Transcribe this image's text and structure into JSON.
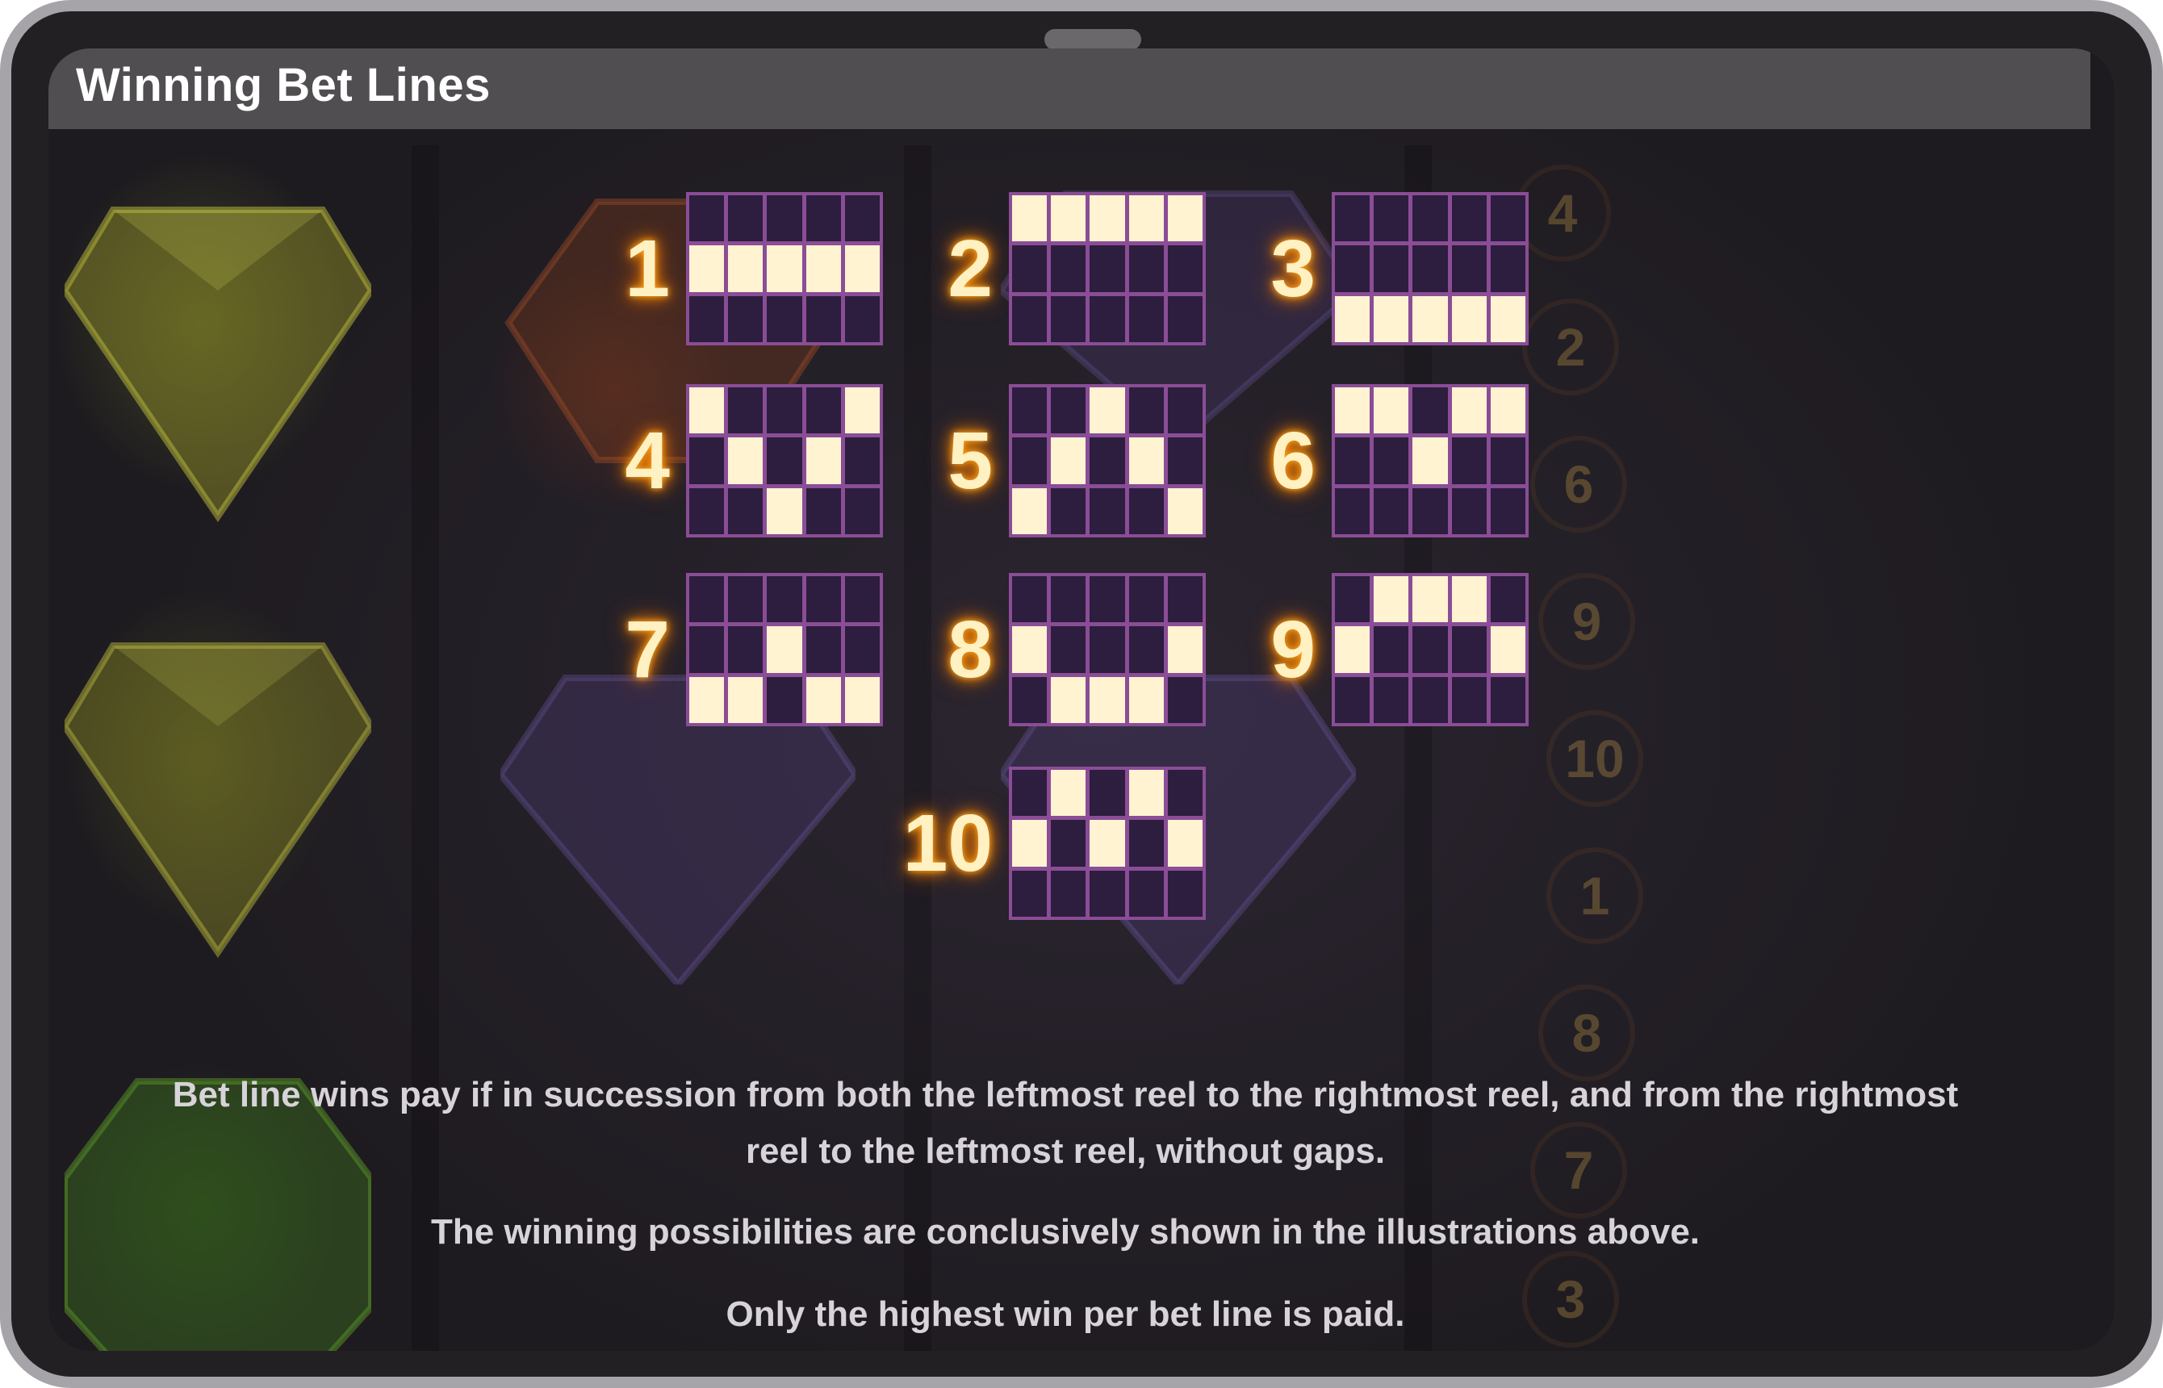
{
  "title": "Winning Bet Lines",
  "paylines": [
    {
      "number": "1",
      "pattern": [
        [
          0,
          0,
          0,
          0,
          0
        ],
        [
          1,
          1,
          1,
          1,
          1
        ],
        [
          0,
          0,
          0,
          0,
          0
        ]
      ]
    },
    {
      "number": "2",
      "pattern": [
        [
          1,
          1,
          1,
          1,
          1
        ],
        [
          0,
          0,
          0,
          0,
          0
        ],
        [
          0,
          0,
          0,
          0,
          0
        ]
      ]
    },
    {
      "number": "3",
      "pattern": [
        [
          0,
          0,
          0,
          0,
          0
        ],
        [
          0,
          0,
          0,
          0,
          0
        ],
        [
          1,
          1,
          1,
          1,
          1
        ]
      ]
    },
    {
      "number": "4",
      "pattern": [
        [
          1,
          0,
          0,
          0,
          1
        ],
        [
          0,
          1,
          0,
          1,
          0
        ],
        [
          0,
          0,
          1,
          0,
          0
        ]
      ]
    },
    {
      "number": "5",
      "pattern": [
        [
          0,
          0,
          1,
          0,
          0
        ],
        [
          0,
          1,
          0,
          1,
          0
        ],
        [
          1,
          0,
          0,
          0,
          1
        ]
      ]
    },
    {
      "number": "6",
      "pattern": [
        [
          1,
          1,
          0,
          1,
          1
        ],
        [
          0,
          0,
          1,
          0,
          0
        ],
        [
          0,
          0,
          0,
          0,
          0
        ]
      ]
    },
    {
      "number": "7",
      "pattern": [
        [
          0,
          0,
          0,
          0,
          0
        ],
        [
          0,
          0,
          1,
          0,
          0
        ],
        [
          1,
          1,
          0,
          1,
          1
        ]
      ]
    },
    {
      "number": "8",
      "pattern": [
        [
          0,
          0,
          0,
          0,
          0
        ],
        [
          1,
          0,
          0,
          0,
          1
        ],
        [
          0,
          1,
          1,
          1,
          0
        ]
      ]
    },
    {
      "number": "9",
      "pattern": [
        [
          0,
          1,
          1,
          1,
          0
        ],
        [
          1,
          0,
          0,
          0,
          1
        ],
        [
          0,
          0,
          0,
          0,
          0
        ]
      ]
    },
    {
      "number": "10",
      "pattern": [
        [
          0,
          1,
          0,
          1,
          0
        ],
        [
          1,
          0,
          1,
          0,
          1
        ],
        [
          0,
          0,
          0,
          0,
          0
        ]
      ]
    }
  ],
  "reel_indicators": [
    "4",
    "2",
    "6",
    "9",
    "10",
    "1",
    "8",
    "7",
    "3"
  ],
  "description": {
    "line1": "Bet line wins pay if in succession from both the leftmost reel to the rightmost reel, and from the rightmost reel to the leftmost reel, without gaps.",
    "line2": "The winning possibilities are conclusively shown in the illustrations above.",
    "line3": "Only the highest win per bet line is paid."
  }
}
